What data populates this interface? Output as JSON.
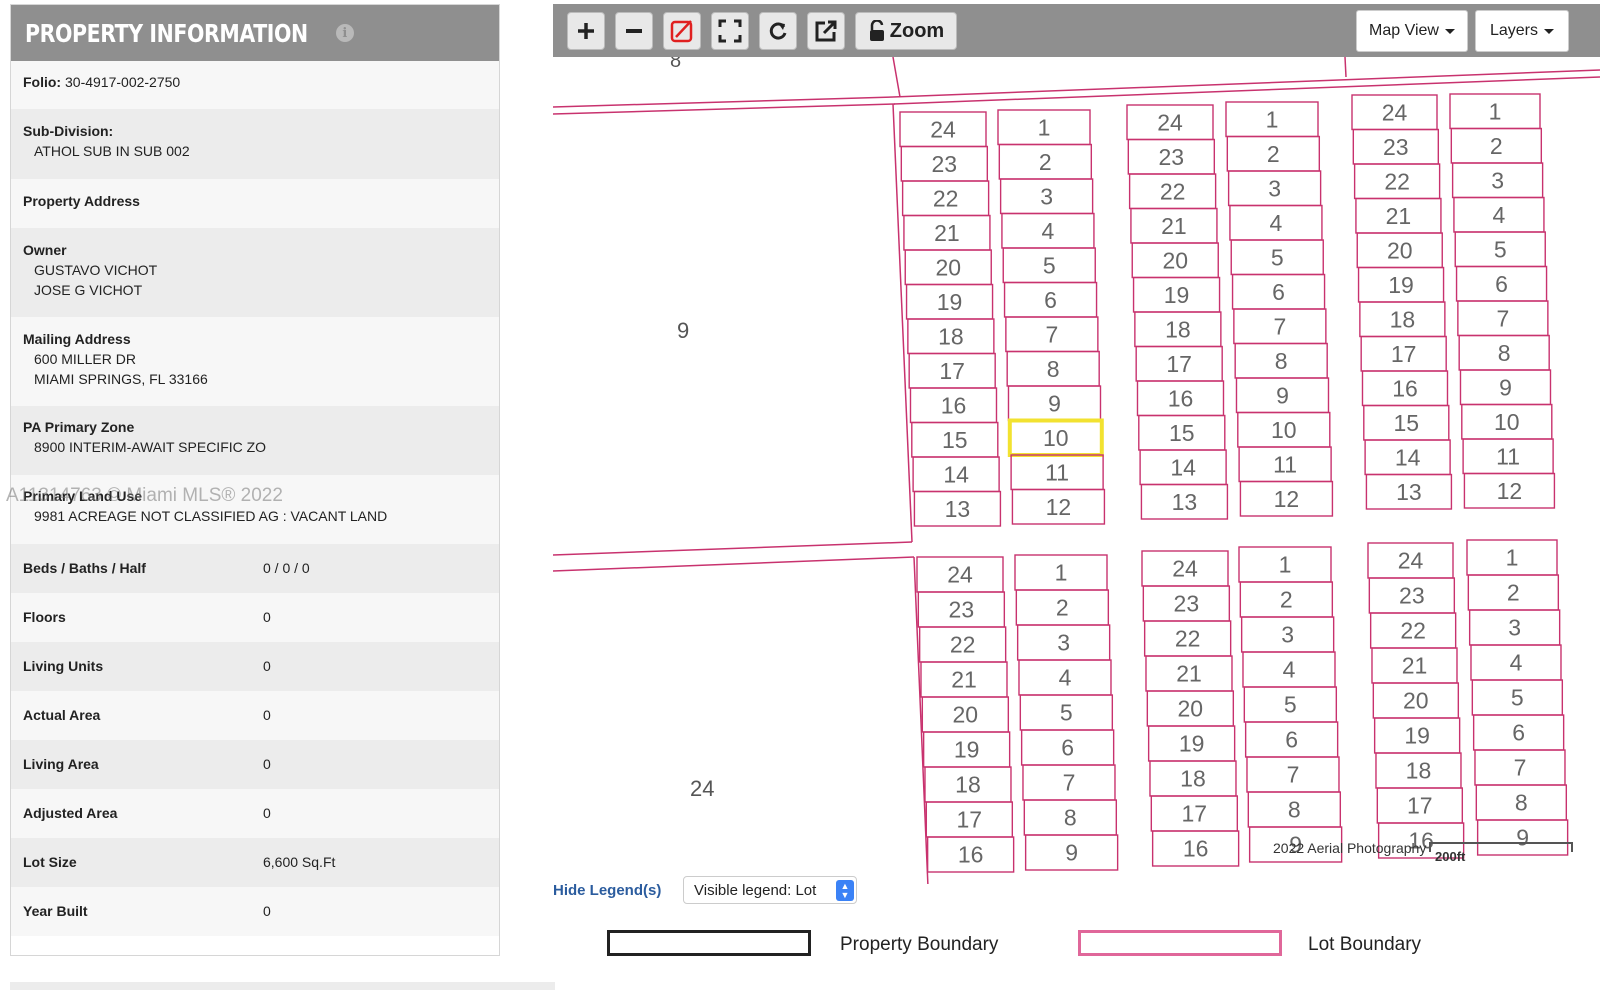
{
  "panel": {
    "title": "PROPERTY INFORMATION",
    "rows": {
      "folio_label": "Folio:",
      "folio_value": "30-4917-002-2750",
      "subdivision_label": "Sub-Division:",
      "subdivision_value": "ATHOL SUB IN SUB 002",
      "address_label": "Property Address",
      "owner_label": "Owner",
      "owner_1": "GUSTAVO VICHOT",
      "owner_2": "JOSE G VICHOT",
      "mailing_label": "Mailing Address",
      "mailing_1": "600 MILLER DR",
      "mailing_2": "MIAMI SPRINGS, FL 33166",
      "zone_label": "PA Primary Zone",
      "zone_value": "8900 INTERIM-AWAIT SPECIFIC ZO",
      "landuse_label": "Primary Land Use",
      "landuse_value": "9981 ACREAGE NOT CLASSIFIED AG : VACANT LAND"
    },
    "pairs": [
      {
        "label": "Beds / Baths / Half",
        "value": "0 / 0 / 0"
      },
      {
        "label": "Floors",
        "value": "0"
      },
      {
        "label": "Living Units",
        "value": "0"
      },
      {
        "label": "Actual Area",
        "value": "0"
      },
      {
        "label": "Living Area",
        "value": "0"
      },
      {
        "label": "Adjusted Area",
        "value": "0"
      },
      {
        "label": "Lot Size",
        "value": "6,600 Sq.Ft"
      },
      {
        "label": "Year Built",
        "value": "0"
      }
    ]
  },
  "watermark": "A11314763 © Miami MLS® 2022",
  "map": {
    "toolbar": {
      "zoom_label": "Zoom",
      "map_view_label": "Map View",
      "layers_label": "Layers"
    },
    "parcel_labels": [
      "8",
      "9",
      "24"
    ],
    "selected_lot": "10",
    "aerial_label": "2022 Aerial Photography",
    "scale_label": "200ft",
    "colors": {
      "lot_boundary": "#c8326e",
      "selected": "#f2e230",
      "road": "#c8326e"
    }
  },
  "legend": {
    "hide_label": "Hide Legend(s)",
    "select_value": "Visible legend: Lot",
    "property_boundary_label": "Property Boundary",
    "lot_boundary_label": "Lot Boundary",
    "property_boundary_color": "#222222",
    "lot_boundary_color": "#e0679a"
  }
}
